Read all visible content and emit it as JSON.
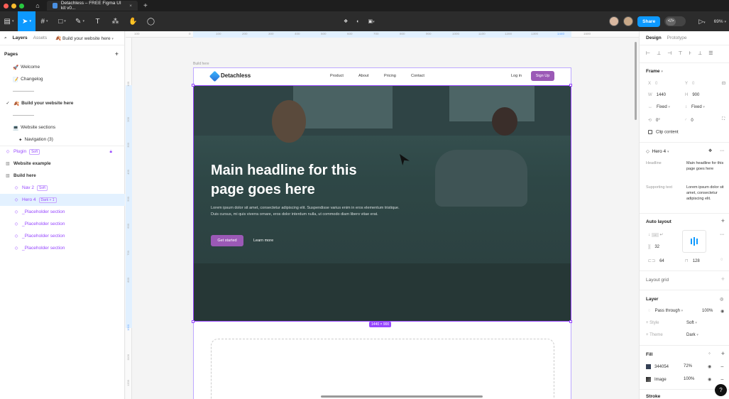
{
  "window": {
    "tab_title": "Detachless – FREE Figma UI kit v0...",
    "colors": {
      "accent": "#0d99ff",
      "brand": "#9b59b6",
      "selection": "#9747ff"
    }
  },
  "toolbar": {
    "share_label": "Share",
    "zoom": "69%",
    "dev_mode_label": "</>"
  },
  "left_panel": {
    "tabs": [
      "Layers",
      "Assets"
    ],
    "current_page": "Build your website here",
    "pages_header": "Pages",
    "pages": [
      {
        "icon": "🚀",
        "label": "Welcome"
      },
      {
        "icon": "📝",
        "label": "Changelog"
      },
      {
        "icon": "🍂",
        "label": "Build your website here"
      },
      {
        "icon": "💻",
        "label": "Website sections"
      },
      {
        "icon": "✦",
        "label": "Navigation (3)"
      }
    ],
    "layers": [
      {
        "label": "Plugin",
        "badge": "Soft"
      },
      {
        "label": "Website example"
      },
      {
        "label": "Build here"
      },
      {
        "label": "Nav 2",
        "badge": "Soft"
      },
      {
        "label": "Hero 4",
        "badge": "Dark + 1"
      },
      {
        "label": "_Placeholder section"
      },
      {
        "label": "_Placeholder section"
      },
      {
        "label": "_Placeholder section"
      },
      {
        "label": "_Placeholder section"
      }
    ]
  },
  "canvas": {
    "ruler_top": [
      "100",
      "0",
      "100",
      "200",
      "300",
      "400",
      "500",
      "600",
      "700",
      "800",
      "900",
      "1000",
      "1100",
      "1200",
      "1300",
      "1440",
      "1500"
    ],
    "ruler_left": [
      "0",
      "100",
      "200",
      "300",
      "400",
      "500",
      "600",
      "700",
      "800",
      "900",
      "1000",
      "1100",
      "1200"
    ],
    "frame_label": "Build here",
    "size_badge": "1440 × 900",
    "site": {
      "logo": "Detachless",
      "nav_links": [
        "Product",
        "About",
        "Pricing",
        "Contact"
      ],
      "login": "Log in",
      "signup": "Sign Up",
      "headline": "Main headline for this page goes here",
      "body": "Lorem ipsum dolor sit amet, consectetur adipiscing elit. Suspendisse varius enim in eros elementum tristique. Duis cursus, mi quis viverra ornare, eros dolor interdum nulla, ut commodo diam libero vitae erat.",
      "cta": "Get started",
      "secondary": "Learn more"
    }
  },
  "right_panel": {
    "tabs": [
      "Design",
      "Prototype"
    ],
    "frame": {
      "title": "Frame",
      "x": "0",
      "y": "0",
      "w": "1440",
      "h": "900",
      "w_mode": "Fixed",
      "h_mode": "Fixed",
      "rotation": "0°",
      "radius": "0",
      "clip_content": "Clip content"
    },
    "component": {
      "name": "Hero 4",
      "props": [
        {
          "label": "Headline",
          "value": "Main headline for this page goes here"
        },
        {
          "label": "Supporting text",
          "value": "Lorem ipsum dolor sit amet, consectetur adipiscing elit."
        }
      ]
    },
    "auto_layout": {
      "title": "Auto layout",
      "gap": "32",
      "pad_h": "64",
      "pad_v": "128"
    },
    "layout_grid": "Layout grid",
    "layer": {
      "title": "Layer",
      "blend": "Pass through",
      "opacity": "100%",
      "style_label": "Style",
      "style_value": "Soft",
      "theme_label": "Theme",
      "theme_value": "Dark"
    },
    "fill": {
      "title": "Fill",
      "items": [
        {
          "name": "344054",
          "opacity": "72%",
          "color": "#344054"
        },
        {
          "name": "Image",
          "opacity": "100%",
          "color": "#555555"
        }
      ]
    },
    "stroke": "Stroke",
    "help": "?"
  }
}
